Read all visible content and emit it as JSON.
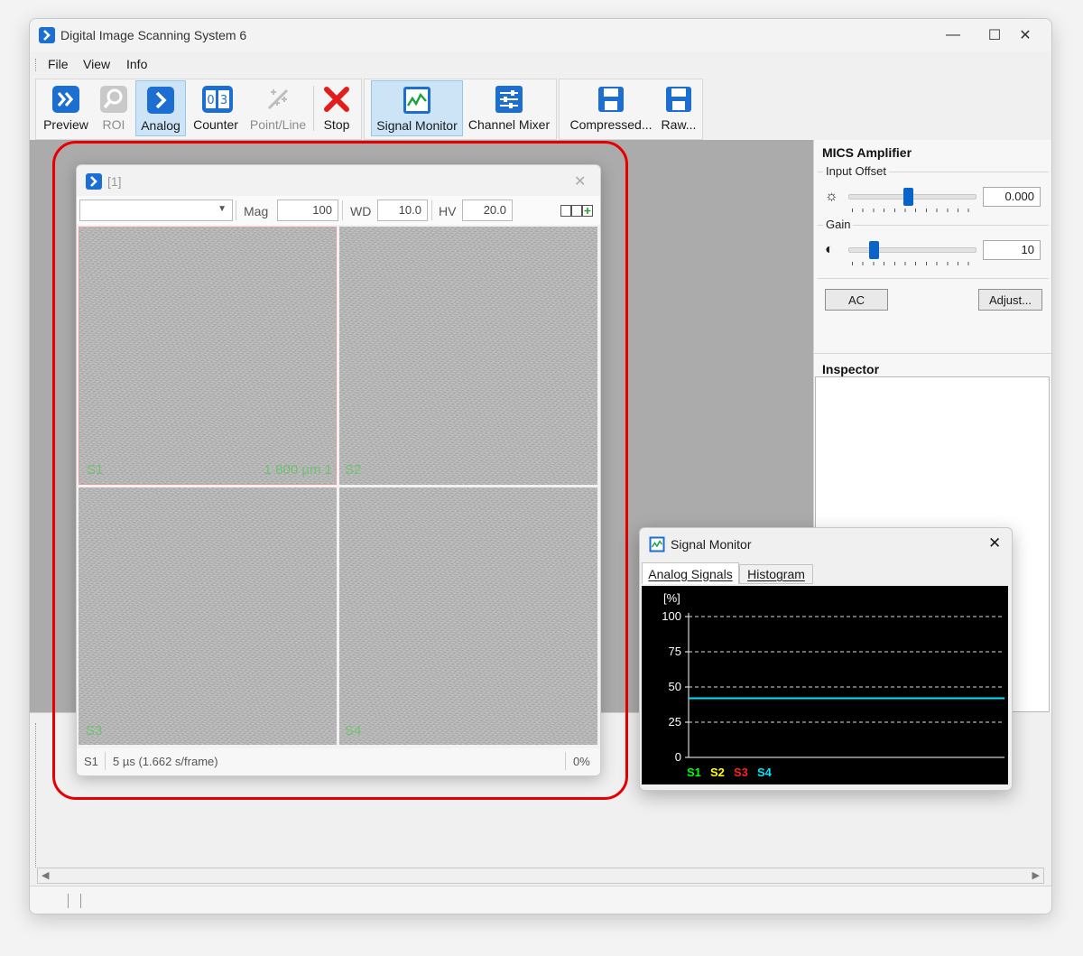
{
  "window": {
    "title": "Digital Image Scanning System 6",
    "minimize": "—",
    "maximize": "☐",
    "close": "✕"
  },
  "menu": {
    "items": [
      "File",
      "View",
      "Info"
    ]
  },
  "toolbar": {
    "preview": "Preview",
    "roi": "ROI",
    "analog": "Analog",
    "counter": "Counter",
    "point_line": "Point/Line",
    "stop": "Stop",
    "signal_monitor": "Signal Monitor",
    "channel_mixer": "Channel Mixer",
    "compressed": "Compressed...",
    "raw": "Raw..."
  },
  "image_window": {
    "title": "[1]",
    "close": "✕",
    "mag_label": "Mag",
    "mag_value": "100",
    "wd_label": "WD",
    "wd_value": "10.0",
    "hv_label": "HV",
    "hv_value": "20.0",
    "panels": [
      {
        "label": "S1",
        "scale": "1 800 µm  1"
      },
      {
        "label": "S2"
      },
      {
        "label": "S3"
      },
      {
        "label": "S4"
      }
    ],
    "status_channel": "S1",
    "status_timing": "5 µs (1.662 s/frame)",
    "status_progress": "0%",
    "progress_fraction": 0.0
  },
  "right_panel": {
    "amplifier_title": "MICS Amplifier",
    "input_offset_label": "Input Offset",
    "input_offset_value": "0.000",
    "input_offset_level": 0.47,
    "gain_label": "Gain",
    "gain_value": "10",
    "gain_level": 0.2,
    "ac_button": "AC",
    "adjust_button": "Adjust...",
    "inspector_title": "Inspector"
  },
  "signal_monitor": {
    "title": "Signal Monitor",
    "close": "✕",
    "tabs": [
      "Analog Signals",
      "Histogram"
    ],
    "active_tab": "Analog Signals",
    "chart_data": {
      "type": "line",
      "ylabel": "[%]",
      "ylim": [
        0,
        100
      ],
      "yticks": [
        "100",
        "75",
        "50",
        "25",
        "0"
      ],
      "grid": true,
      "series": [
        {
          "name": "S1",
          "color": "#00ff00",
          "values": []
        },
        {
          "name": "S2",
          "color": "#ffff00",
          "values": []
        },
        {
          "name": "S3",
          "color": "#ff2020",
          "values": []
        },
        {
          "name": "S4",
          "color": "#00e5ff",
          "values": [
            42,
            42
          ]
        }
      ]
    }
  },
  "colors": {
    "accent": "#1c6fd1",
    "highlight_outline": "#e60000",
    "active_button": "#cde4f7"
  }
}
